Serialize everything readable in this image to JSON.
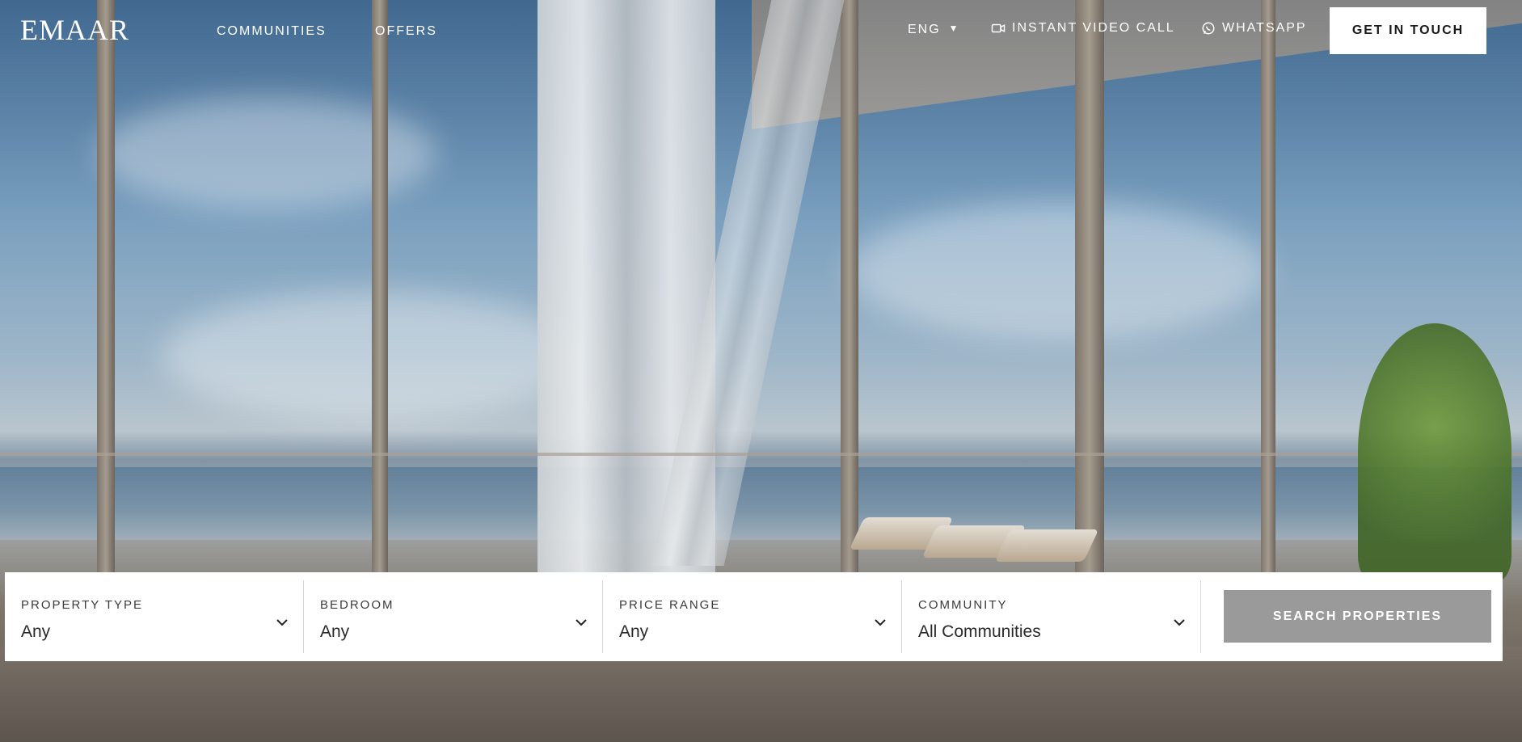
{
  "header": {
    "logo": "EMAAR",
    "nav": [
      {
        "label": "COMMUNITIES"
      },
      {
        "label": "OFFERS"
      }
    ],
    "language": "ENG",
    "video_call_label": "INSTANT VIDEO CALL",
    "whatsapp_label": "WHATSAPP",
    "cta_label": "GET IN TOUCH"
  },
  "search": {
    "filters": [
      {
        "label": "PROPERTY TYPE",
        "value": "Any"
      },
      {
        "label": "BEDROOM",
        "value": "Any"
      },
      {
        "label": "PRICE RANGE",
        "value": "Any"
      },
      {
        "label": "COMMUNITY",
        "value": "All Communities"
      }
    ],
    "button_label": "SEARCH PROPERTIES"
  },
  "icons": {
    "video": "video-camera-icon",
    "whatsapp": "whatsapp-icon",
    "chevron": "chevron-down-icon",
    "caret": "caret-down-icon"
  }
}
